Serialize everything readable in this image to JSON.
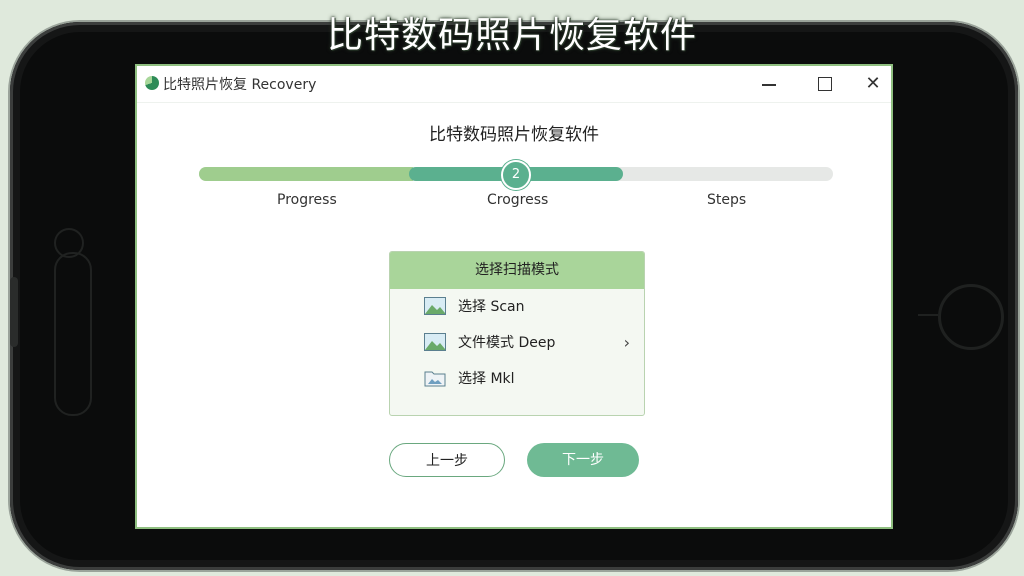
{
  "caption": "比特数码照片恢复软件",
  "window": {
    "app_title": "比特照片恢复 Recovery",
    "controls": {
      "minimize": "",
      "maximize": "",
      "close": "✕"
    }
  },
  "main": {
    "title": "比特数码照片恢复软件",
    "progress": {
      "current_step": "2",
      "fraction_complete": 0.66
    },
    "steps": [
      "Progress",
      "Crogress",
      "Steps"
    ]
  },
  "scan_card": {
    "header": "选择扫描模式",
    "items": [
      {
        "label": "选择 Scan",
        "icon": "image-icon"
      },
      {
        "label": "文件模式 Deep",
        "icon": "image-icon",
        "has_chevron": true
      },
      {
        "label": "选择 Mkl",
        "icon": "folder-image-icon"
      }
    ],
    "chevron": "›"
  },
  "buttons": {
    "prev": "上一步",
    "next": "下一步"
  },
  "colors": {
    "accent": "#5bb08f",
    "light_green": "#a9d59a",
    "frame": "#8fbf80"
  }
}
